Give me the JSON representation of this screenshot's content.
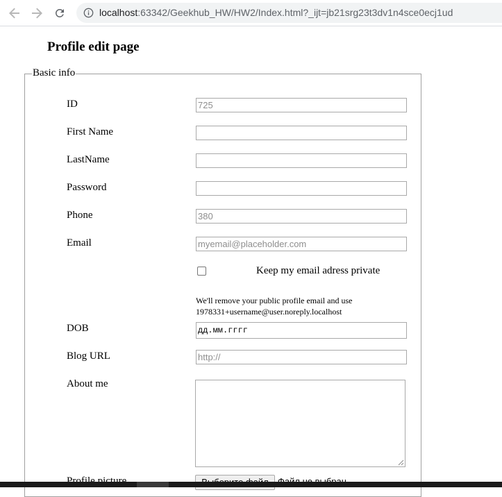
{
  "browser": {
    "url_host": "localhost",
    "url_path": ":63342/Geekhub_HW/HW2/Index.html?_ijt=jb21srg23t3dv1n4sce0ecj1ud",
    "icons": {
      "back": "back-arrow-icon",
      "forward": "forward-arrow-icon",
      "reload": "reload-icon",
      "info": "info-icon"
    }
  },
  "page": {
    "title": "Profile edit page"
  },
  "form": {
    "legend": "Basic info",
    "fields": {
      "id": {
        "label": "ID",
        "placeholder": "725",
        "value": ""
      },
      "first_name": {
        "label": "First Name",
        "placeholder": "",
        "value": ""
      },
      "last_name": {
        "label": "LastName",
        "placeholder": "",
        "value": ""
      },
      "password": {
        "label": "Password",
        "placeholder": "",
        "value": ""
      },
      "phone": {
        "label": "Phone",
        "placeholder": "380",
        "value": ""
      },
      "email": {
        "label": "Email",
        "placeholder": "myemail@placeholder.com",
        "value": ""
      },
      "keep_private": {
        "label": "Keep my email adress private",
        "checked": false,
        "hint": "We'll remove your public profile email and use 1978331+username@user.noreply.localhost"
      },
      "dob": {
        "label": "DOB",
        "value": "дд.мм.гггг"
      },
      "blog_url": {
        "label": "Blog URL",
        "placeholder": "http://",
        "value": ""
      },
      "about_me": {
        "label": "About me",
        "value": ""
      },
      "profile_picture": {
        "label": "Profile picture",
        "button_label": "Выберите файл",
        "status": "Файл не выбран"
      }
    }
  },
  "colors": {
    "omnibox_bg": "#f1f3f4",
    "input_border": "#a9a9a9",
    "placeholder_text": "#8e8e8e",
    "fieldset_border": "#a0a0a0",
    "taskbar": "#1b1b1b"
  }
}
